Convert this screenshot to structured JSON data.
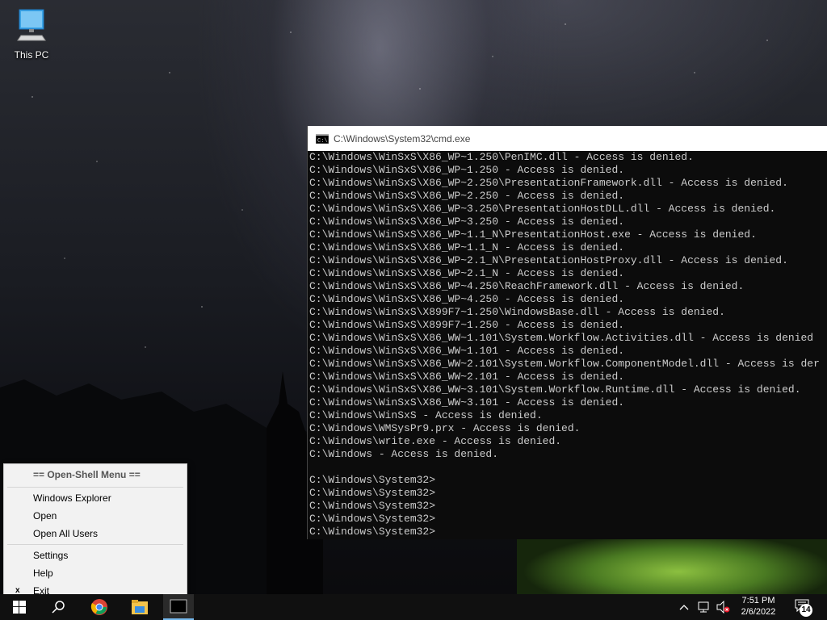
{
  "desktop": {
    "icons": [
      {
        "label": "This PC",
        "icon": "this-pc-icon"
      }
    ]
  },
  "cmd": {
    "title": "C:\\Windows\\System32\\cmd.exe",
    "lines": [
      "C:\\Windows\\WinSxS\\X86_WP~1.250\\PenIMC.dll - Access is denied.",
      "C:\\Windows\\WinSxS\\X86_WP~1.250 - Access is denied.",
      "C:\\Windows\\WinSxS\\X86_WP~2.250\\PresentationFramework.dll - Access is denied.",
      "C:\\Windows\\WinSxS\\X86_WP~2.250 - Access is denied.",
      "C:\\Windows\\WinSxS\\X86_WP~3.250\\PresentationHostDLL.dll - Access is denied.",
      "C:\\Windows\\WinSxS\\X86_WP~3.250 - Access is denied.",
      "C:\\Windows\\WinSxS\\X86_WP~1.1_N\\PresentationHost.exe - Access is denied.",
      "C:\\Windows\\WinSxS\\X86_WP~1.1_N - Access is denied.",
      "C:\\Windows\\WinSxS\\X86_WP~2.1_N\\PresentationHostProxy.dll - Access is denied.",
      "C:\\Windows\\WinSxS\\X86_WP~2.1_N - Access is denied.",
      "C:\\Windows\\WinSxS\\X86_WP~4.250\\ReachFramework.dll - Access is denied.",
      "C:\\Windows\\WinSxS\\X86_WP~4.250 - Access is denied.",
      "C:\\Windows\\WinSxS\\X899F7~1.250\\WindowsBase.dll - Access is denied.",
      "C:\\Windows\\WinSxS\\X899F7~1.250 - Access is denied.",
      "C:\\Windows\\WinSxS\\X86_WW~1.101\\System.Workflow.Activities.dll - Access is denied",
      "C:\\Windows\\WinSxS\\X86_WW~1.101 - Access is denied.",
      "C:\\Windows\\WinSxS\\X86_WW~2.101\\System.Workflow.ComponentModel.dll - Access is der",
      "C:\\Windows\\WinSxS\\X86_WW~2.101 - Access is denied.",
      "C:\\Windows\\WinSxS\\X86_WW~3.101\\System.Workflow.Runtime.dll - Access is denied.",
      "C:\\Windows\\WinSxS\\X86_WW~3.101 - Access is denied.",
      "C:\\Windows\\WinSxS - Access is denied.",
      "C:\\Windows\\WMSysPr9.prx - Access is denied.",
      "C:\\Windows\\write.exe - Access is denied.",
      "C:\\Windows - Access is denied.",
      "",
      "C:\\Windows\\System32>",
      "C:\\Windows\\System32>",
      "C:\\Windows\\System32>",
      "C:\\Windows\\System32>",
      "C:\\Windows\\System32>"
    ]
  },
  "menu": {
    "header": "== Open-Shell Menu ==",
    "items_group1": [
      "Windows Explorer",
      "Open",
      "Open All Users"
    ],
    "items_group2": [
      "Settings",
      "Help"
    ],
    "exit_label": "Exit",
    "exit_mark": "x"
  },
  "taskbar": {
    "time": "7:51 PM",
    "date": "2/6/2022",
    "notification_count": "14"
  }
}
